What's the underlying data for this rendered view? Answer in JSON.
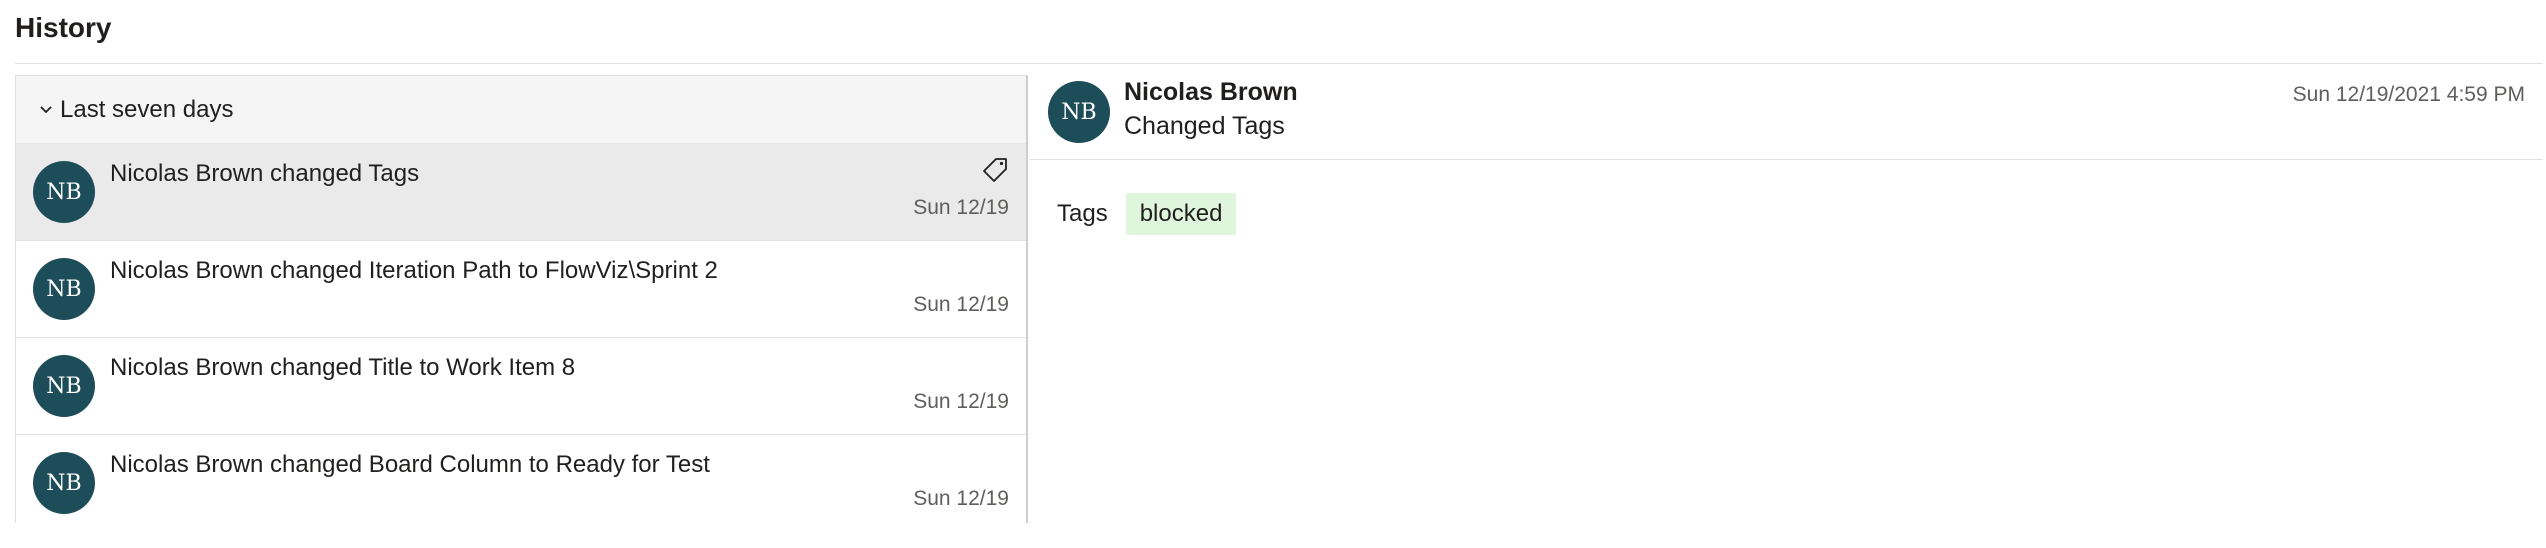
{
  "page": {
    "title": "History"
  },
  "list": {
    "group_label": "Last seven days",
    "items": [
      {
        "initials": "NB",
        "text": "Nicolas Brown changed Tags",
        "date": "Sun 12/19",
        "icon": "tag-icon"
      },
      {
        "initials": "NB",
        "text": "Nicolas Brown changed Iteration Path to FlowViz\\Sprint 2",
        "date": "Sun 12/19"
      },
      {
        "initials": "NB",
        "text": "Nicolas Brown changed Title to Work Item 8",
        "date": "Sun 12/19"
      },
      {
        "initials": "NB",
        "text": "Nicolas Brown changed Board Column to Ready for Test",
        "date": "Sun 12/19"
      }
    ]
  },
  "detail": {
    "initials": "NB",
    "user": "Nicolas Brown",
    "action": "Changed Tags",
    "timestamp": "Sun 12/19/2021 4:59 PM",
    "field_label": "Tags",
    "tag_value": "blocked"
  },
  "colors": {
    "avatar_bg": "#1e4d5a",
    "selected_row_bg": "#eaeaea",
    "tag_chip_bg": "#dff6dd"
  }
}
